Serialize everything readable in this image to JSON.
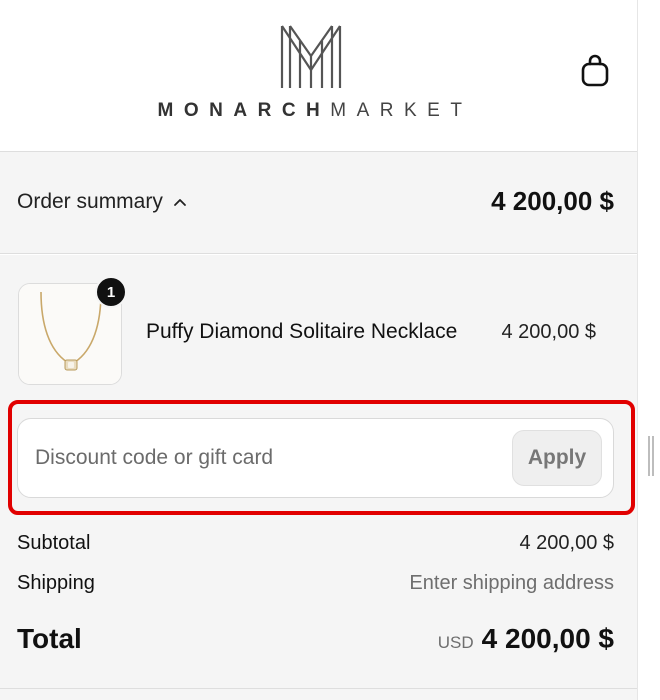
{
  "brand": {
    "name_bold": "MONARCH",
    "name_light": "MARKET"
  },
  "header": {
    "cart_icon": "shopping-bag-icon"
  },
  "summary": {
    "toggle_label": "Order summary",
    "toggle_icon": "chevron-up-icon",
    "total": "4 200,00 $"
  },
  "items": [
    {
      "quantity": "1",
      "name": "Puffy Diamond Solitaire Necklace",
      "price": "4 200,00 $"
    }
  ],
  "discount": {
    "placeholder": "Discount code or gift card",
    "value": "",
    "apply_label": "Apply"
  },
  "totals": {
    "subtotal_label": "Subtotal",
    "subtotal_value": "4 200,00 $",
    "shipping_label": "Shipping",
    "shipping_value": "Enter shipping address",
    "total_label": "Total",
    "currency": "USD",
    "total_value": "4 200,00 $"
  },
  "colors": {
    "highlight": "#e10000",
    "summary_bg": "#f5f5f5",
    "badge": "#111111"
  }
}
